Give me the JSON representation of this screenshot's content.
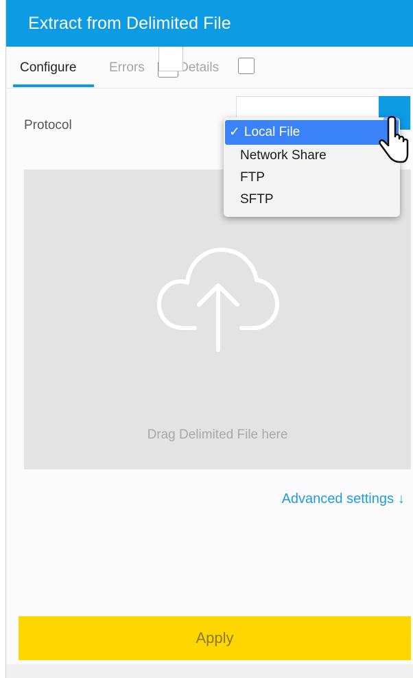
{
  "header": {
    "title": "Extract from Delimited File"
  },
  "tabs": [
    {
      "label": "Configure"
    },
    {
      "label": "Errors"
    },
    {
      "label": "Details"
    }
  ],
  "protocol": {
    "label": "Protocol",
    "options": [
      "Local File",
      "Network Share",
      "FTP",
      "SFTP"
    ],
    "selected": "Local File",
    "check_mark": "✓"
  },
  "dropzone": {
    "text": "Drag Delimited File here"
  },
  "advanced": {
    "label": "Advanced settings",
    "arrow": "↓"
  },
  "apply": {
    "label": "Apply"
  },
  "colors": {
    "accent": "#0d9be4",
    "apply": "#ffd600",
    "selection": "#3a82f7"
  }
}
